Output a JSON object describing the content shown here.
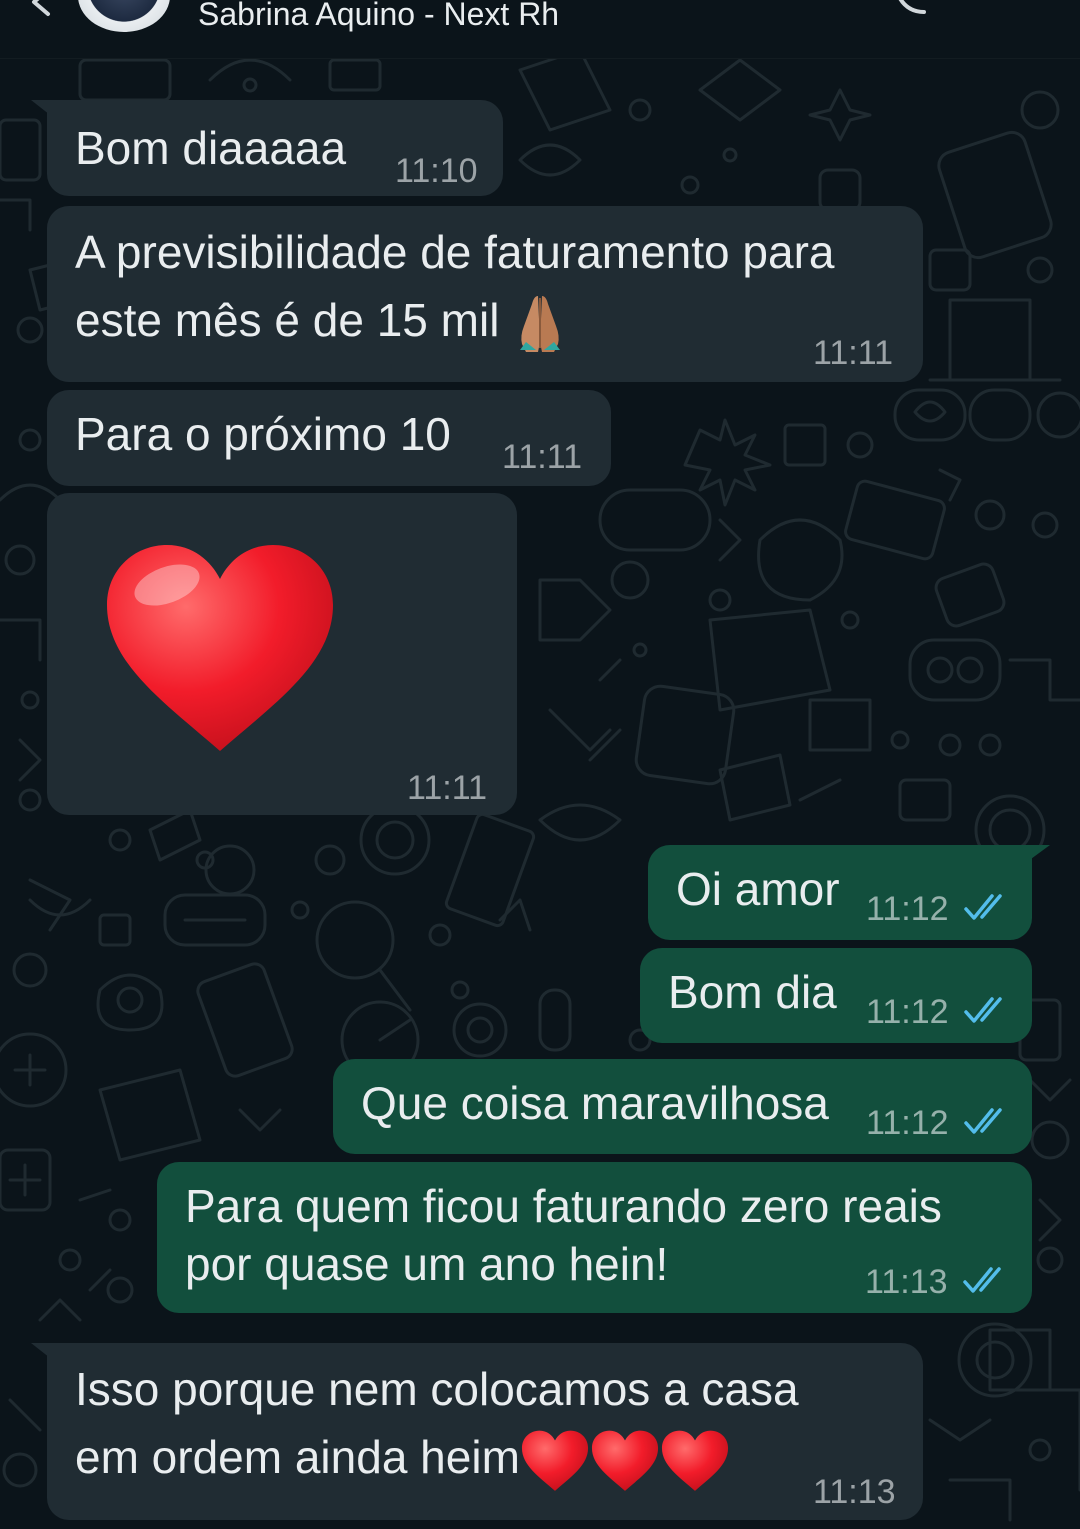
{
  "colors": {
    "background": "#0b141a",
    "incoming_bubble": "#202c33",
    "outgoing_bubble": "#124f3d",
    "read_tick": "#53bdeb",
    "text": "#e9edef"
  },
  "header": {
    "contact_name": "Sabrina Aquino - Next Rh",
    "back_icon": "back-arrow-icon",
    "call_icon": "phone-call-icon",
    "menu_icon": "more-vert-icon"
  },
  "messages": [
    {
      "direction": "in",
      "text": "Bom diaaaaa",
      "time": "11:10"
    },
    {
      "direction": "in",
      "line1": "A previsibilidade de faturamento para",
      "line2": "este mês é de 15 mil",
      "emoji": "folded-hands",
      "time": "11:11"
    },
    {
      "direction": "in",
      "text": "Para o próximo 10",
      "time": "11:11"
    },
    {
      "direction": "in",
      "sticker": "red-heart",
      "time": "11:11"
    },
    {
      "direction": "out",
      "text": "Oi amor",
      "time": "11:12",
      "status": "read"
    },
    {
      "direction": "out",
      "text": "Bom dia",
      "time": "11:12",
      "status": "read"
    },
    {
      "direction": "out",
      "text": "Que coisa maravilhosa",
      "time": "11:12",
      "status": "read"
    },
    {
      "direction": "out",
      "line1": "Para quem ficou faturando zero reais",
      "line2": "por quase um ano hein!",
      "time": "11:13",
      "status": "read"
    },
    {
      "direction": "in",
      "line1": "Isso porque nem colocamos a casa",
      "line2": "em ordem ainda heim",
      "emoji": "red-heart x3",
      "time": "11:13"
    }
  ]
}
